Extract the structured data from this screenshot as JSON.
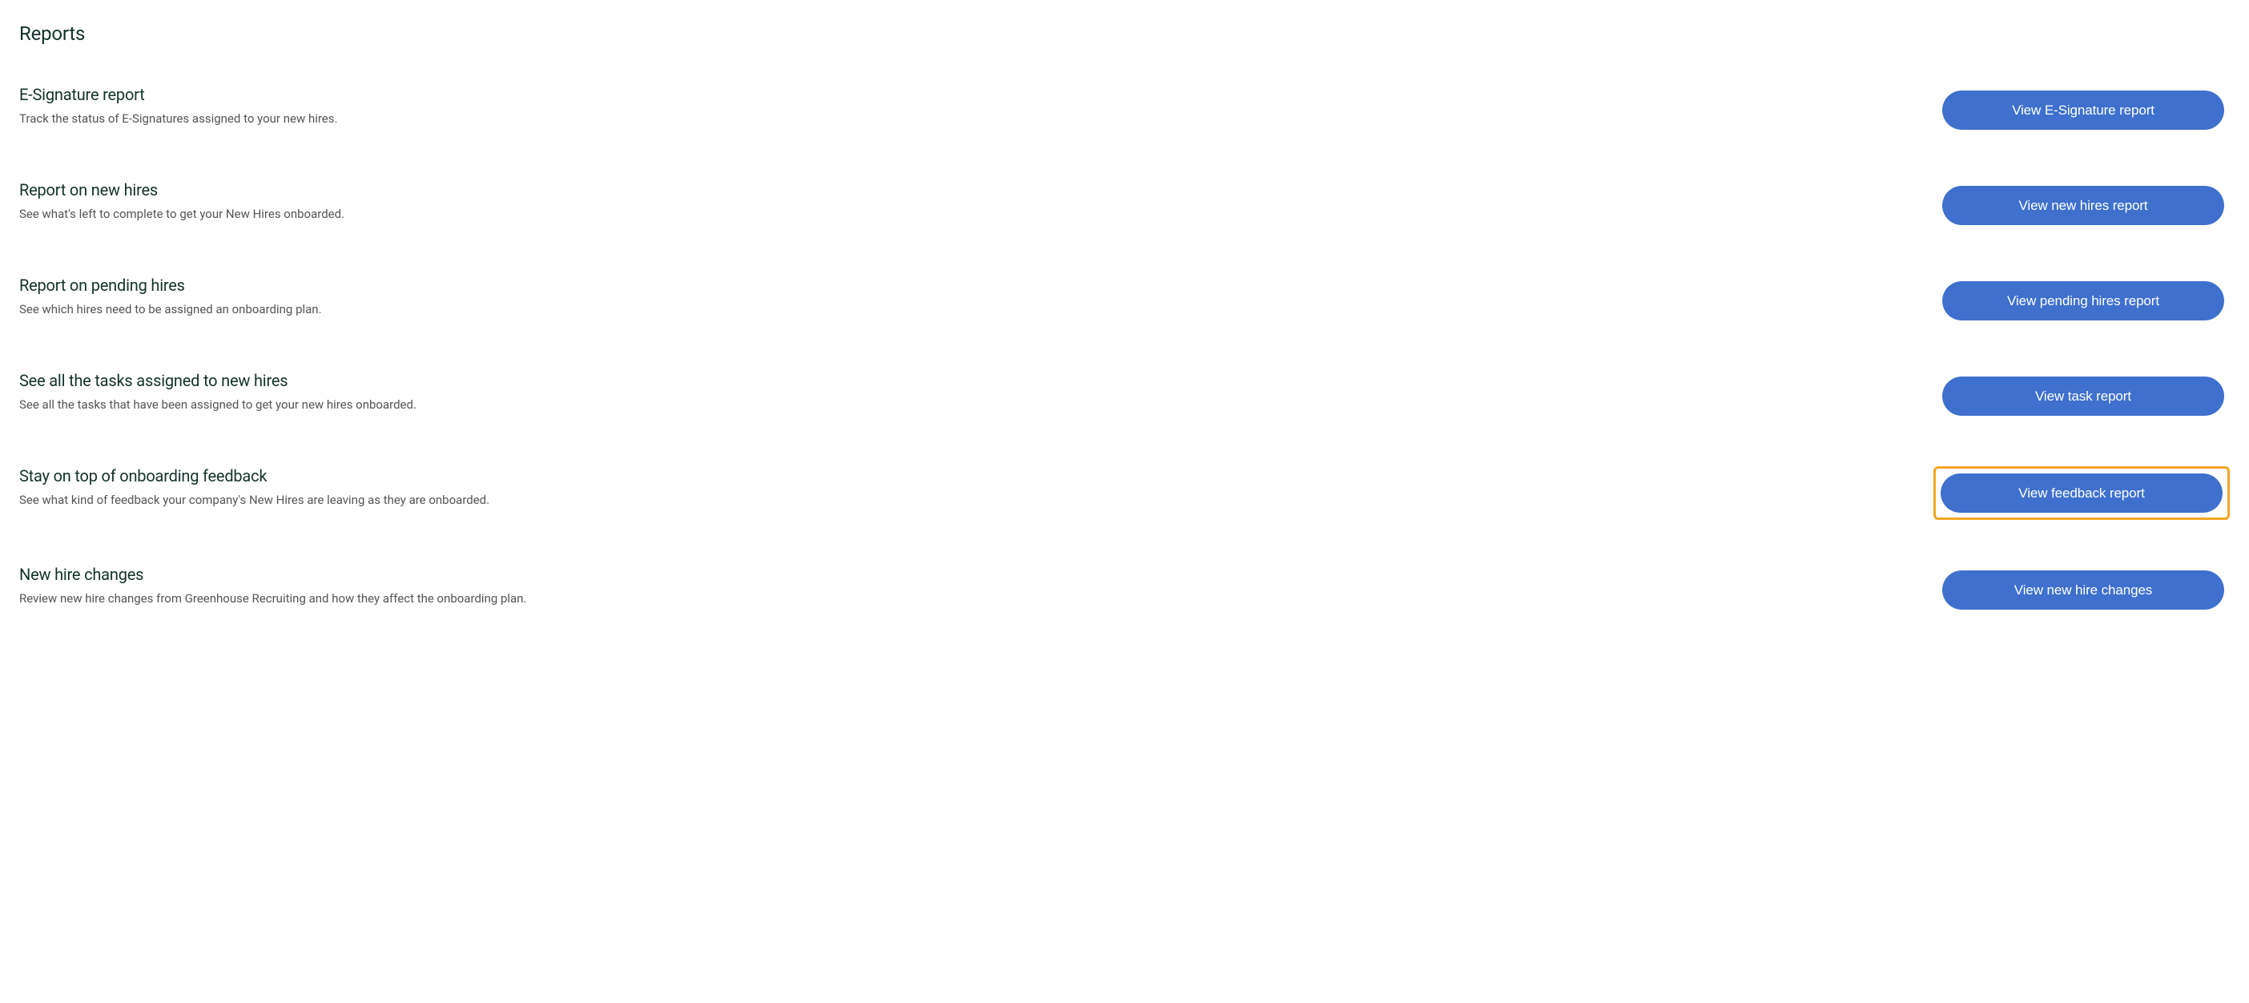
{
  "page": {
    "title": "Reports"
  },
  "reports": [
    {
      "title": "E-Signature report",
      "description": "Track the status of E-Signatures assigned to your new hires.",
      "button_label": "View E-Signature report",
      "highlighted": false
    },
    {
      "title": "Report on new hires",
      "description": "See what's left to complete to get your New Hires onboarded.",
      "button_label": "View new hires report",
      "highlighted": false
    },
    {
      "title": "Report on pending hires",
      "description": "See which hires need to be assigned an onboarding plan.",
      "button_label": "View pending hires report",
      "highlighted": false
    },
    {
      "title": "See all the tasks assigned to new hires",
      "description": "See all the tasks that have been assigned to get your new hires onboarded.",
      "button_label": "View task report",
      "highlighted": false
    },
    {
      "title": "Stay on top of onboarding feedback",
      "description": "See what kind of feedback your company's New Hires are leaving as they are onboarded.",
      "button_label": "View feedback report",
      "highlighted": true
    },
    {
      "title": "New hire changes",
      "description": "Review new hire changes from Greenhouse Recruiting and how they affect the onboarding plan.",
      "button_label": "View new hire changes",
      "highlighted": false
    }
  ]
}
